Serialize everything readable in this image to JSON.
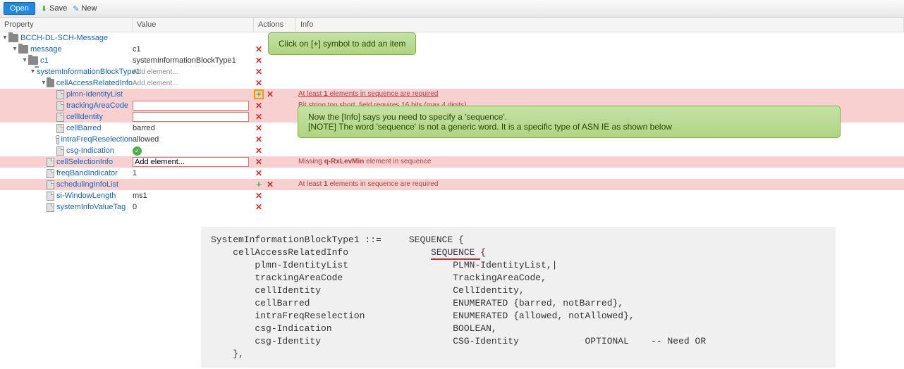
{
  "toolbar": {
    "open": "Open",
    "save": "Save",
    "new": "New"
  },
  "headers": {
    "property": "Property",
    "value": "Value",
    "actions": "Actions",
    "info": "Info"
  },
  "callouts": {
    "c1": "Click on [+] symbol to add an item",
    "c2a": "Now the [Info] says you need to specify a 'sequence'.",
    "c2b": "[NOTE] The word 'sequence' is not a generic word. It is a specific type of ASN IE as shown below"
  },
  "tree": {
    "root": "BCCH-DL-SCH-Message",
    "message": {
      "label": "message",
      "value": "c1"
    },
    "c1": {
      "label": "c1",
      "value": "systemInformationBlockType1"
    },
    "sib1": {
      "label": "systemInformationBlockType1",
      "value": "Add element..."
    },
    "cellAccess": {
      "label": "cellAccessRelatedInfo",
      "value": "Add element..."
    },
    "plmn": {
      "label": "plmn-IdentityList",
      "info_pre": "At least ",
      "info_bold": "1",
      "info_post": " elements in sequence are required"
    },
    "tac": {
      "label": "trackingAreaCode",
      "info_obscured": "Bit string too short, field requires 16 bits (max 4 digits)"
    },
    "cellId": {
      "label": "cellIdentity"
    },
    "cellBarred": {
      "label": "cellBarred",
      "value": "barred"
    },
    "intraFreq": {
      "label": "intraFreqReselection",
      "value": "allowed"
    },
    "csgInd": {
      "label": "csg-Indication"
    },
    "cellSel": {
      "label": "cellSelectionInfo",
      "value": "Add element...",
      "info_pre": "Missing ",
      "info_bold": "q-RxLevMin",
      "info_post": " element in sequence"
    },
    "freqBand": {
      "label": "freqBandIndicator",
      "value": "1"
    },
    "schedList": {
      "label": "schedulingInfoList",
      "info_pre": "At least ",
      "info_bold": "1",
      "info_post": " elements in sequence are required"
    },
    "siWin": {
      "label": "si-WindowLength",
      "value": "ms1"
    },
    "sysValTag": {
      "label": "systemInfoValueTag",
      "value": "0"
    }
  },
  "code": {
    "l1a": "SystemInformationBlockType1 ::=     SEQUENCE {",
    "l2a": "    cellAccessRelatedInfo               ",
    "l2seq": "SEQUENCE ",
    "l2b": "{",
    "l3": "        plmn-IdentityList                   PLMN-IdentityList,|",
    "l4": "        trackingAreaCode                    TrackingAreaCode,",
    "l5": "        cellIdentity                        CellIdentity,",
    "l6": "        cellBarred                          ENUMERATED {barred, notBarred},",
    "l7": "        intraFreqReselection                ENUMERATED {allowed, notAllowed},",
    "l8": "        csg-Indication                      BOOLEAN,",
    "l9": "        csg-Identity                        CSG-Identity            OPTIONAL    -- Need OR",
    "l10": "    },"
  }
}
